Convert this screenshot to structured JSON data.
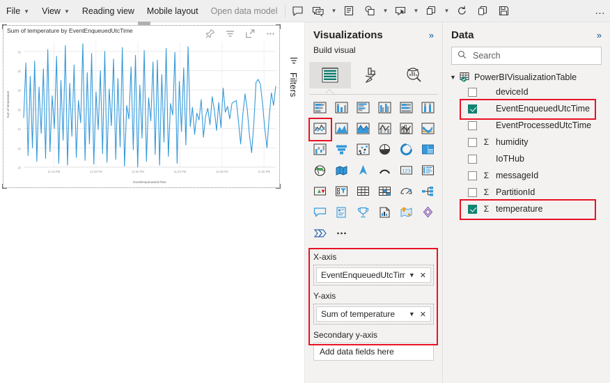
{
  "ribbon": {
    "menus": [
      {
        "label": "File",
        "caret": true,
        "dim": false
      },
      {
        "label": "View",
        "caret": true,
        "dim": false
      },
      {
        "label": "Reading view",
        "caret": false,
        "dim": false
      },
      {
        "label": "Mobile layout",
        "caret": false,
        "dim": false
      },
      {
        "label": "Open data model",
        "caret": false,
        "dim": true
      }
    ],
    "icons": [
      {
        "name": "comment-icon",
        "caret": false
      },
      {
        "name": "chat-bubbles-icon",
        "caret": true
      },
      {
        "name": "text-pane-icon",
        "caret": false
      },
      {
        "name": "shapes-icon",
        "caret": true
      },
      {
        "name": "buttons-icon",
        "caret": true
      },
      {
        "name": "layers-icon",
        "caret": true
      },
      {
        "name": "refresh-icon",
        "caret": false
      },
      {
        "name": "copy-icon",
        "caret": false
      },
      {
        "name": "save-icon",
        "caret": false
      }
    ],
    "overflow_label": "…"
  },
  "visual": {
    "title": "Sum of temperature by EventEnqueuedUtcTime",
    "actions": [
      {
        "name": "pin-icon",
        "tooltip": "Pin to dashboard"
      },
      {
        "name": "filter-icon",
        "tooltip": "Filters"
      },
      {
        "name": "focus-mode-icon",
        "tooltip": "Focus mode"
      },
      {
        "name": "more-options-icon",
        "tooltip": "More options"
      }
    ]
  },
  "chart_data": {
    "type": "line",
    "title": "Sum of temperature by EventEnqueuedUtcTime",
    "xlabel": "EventEnqueuedUtcTime",
    "ylabel": "Sum of temperature",
    "series_color": "#3599da",
    "grid": true,
    "legend": "none",
    "ylim": [
      20,
      33
    ],
    "ytick_labels": [
      "32",
      "30",
      "28",
      "26",
      "24",
      "22",
      "20"
    ],
    "ytick_values": [
      32,
      30,
      28,
      26,
      24,
      22,
      20
    ],
    "xtick_labels": [
      "11:10 PM",
      "11:15 PM",
      "11:20 PM",
      "11:25 PM",
      "11:30 PM",
      "11:35 PM"
    ],
    "x": [
      0,
      1,
      2,
      3,
      4,
      5,
      6,
      7,
      8,
      9,
      10,
      11,
      12,
      13,
      14,
      15,
      16,
      17,
      18,
      19,
      20,
      21,
      22,
      23,
      24,
      25,
      26,
      27,
      28,
      29,
      30,
      31,
      32,
      33,
      34,
      35,
      36,
      37,
      38,
      39,
      40,
      41,
      42,
      43,
      44,
      45,
      46,
      47,
      48,
      49,
      50,
      51,
      52,
      53,
      54,
      55,
      56,
      57,
      58,
      59,
      60,
      61,
      62,
      63,
      64,
      65,
      66,
      67,
      68,
      69,
      70,
      71,
      72,
      73,
      74,
      75,
      76,
      77,
      78,
      79,
      80,
      81,
      82,
      83,
      84,
      85,
      86,
      87,
      88,
      89,
      90,
      91,
      92,
      93,
      94,
      95,
      96,
      97,
      98,
      99,
      100,
      101,
      102,
      103,
      104,
      105,
      106,
      107,
      108,
      109,
      110,
      111,
      112,
      113,
      114,
      115
    ],
    "values": [
      25.1,
      30.8,
      21.2,
      29.4,
      22.0,
      31.0,
      20.6,
      28.3,
      23.5,
      30.2,
      20.9,
      32.2,
      21.6,
      27.4,
      24.0,
      31.5,
      20.4,
      29.0,
      22.8,
      32.6,
      20.2,
      28.7,
      23.2,
      30.6,
      21.0,
      26.9,
      24.6,
      32.8,
      20.7,
      29.8,
      22.4,
      31.8,
      20.3,
      27.8,
      23.9,
      30.0,
      21.4,
      32.0,
      20.5,
      28.1,
      24.3,
      31.2,
      20.8,
      29.2,
      22.1,
      32.4,
      20.1,
      26.4,
      25.0,
      30.4,
      21.8,
      31.6,
      20.0,
      28.5,
      23.0,
      32.1,
      20.6,
      27.2,
      24.8,
      30.9,
      21.3,
      31.1,
      20.2,
      29.6,
      22.6,
      32.3,
      21.1,
      26.6,
      25.4,
      31.9,
      20.4,
      28.9,
      23.7,
      30.3,
      22.3,
      32.5,
      24.2,
      26.2,
      23.4,
      25.6,
      24.9,
      27.0,
      23.1,
      25.3,
      26.1,
      24.4,
      27.3,
      25.9,
      23.8,
      26.7,
      24.1,
      28.2,
      25.7,
      26.3,
      25.0,
      26.6,
      26.8,
      26.9,
      24.7,
      22.4,
      25.5,
      27.6,
      26.0,
      23.3,
      21.5,
      24.5,
      28.8,
      29.1,
      28.6,
      26.5,
      24.0,
      22.0,
      25.2,
      27.7,
      26.4,
      28.4
    ]
  },
  "filters_pane": {
    "label": "Filters",
    "icon": "filter-icon"
  },
  "visualizations_pane": {
    "title": "Visualizations",
    "expand_icon": "»",
    "section_label": "Build visual",
    "build_tabs": [
      {
        "name": "build-visual-tab",
        "icon": "fields-table-icon",
        "active": true
      },
      {
        "name": "format-visual-tab",
        "icon": "paintbrush-icon",
        "active": false
      },
      {
        "name": "analytics-tab",
        "icon": "magnifier-chart-icon",
        "active": false
      }
    ],
    "gallery": [
      {
        "name": "stacked-bar-chart",
        "selected": false
      },
      {
        "name": "stacked-column-chart",
        "selected": false
      },
      {
        "name": "clustered-bar-chart",
        "selected": false
      },
      {
        "name": "clustered-column-chart",
        "selected": false
      },
      {
        "name": "100-stacked-bar-chart",
        "selected": false
      },
      {
        "name": "100-stacked-column-chart",
        "selected": false
      },
      {
        "name": "line-chart",
        "selected": true
      },
      {
        "name": "area-chart",
        "selected": false
      },
      {
        "name": "stacked-area-chart",
        "selected": false
      },
      {
        "name": "line-and-stacked-column-chart",
        "selected": false
      },
      {
        "name": "line-and-clustered-column-chart",
        "selected": false
      },
      {
        "name": "ribbon-chart",
        "selected": false
      },
      {
        "name": "waterfall-chart",
        "selected": false
      },
      {
        "name": "funnel-chart",
        "selected": false
      },
      {
        "name": "scatter-chart",
        "selected": false
      },
      {
        "name": "pie-chart",
        "selected": false
      },
      {
        "name": "donut-chart",
        "selected": false
      },
      {
        "name": "treemap",
        "selected": false
      },
      {
        "name": "map",
        "selected": false
      },
      {
        "name": "filled-map",
        "selected": false
      },
      {
        "name": "azure-map",
        "selected": false
      },
      {
        "name": "arcgis-map",
        "selected": false
      },
      {
        "name": "card",
        "selected": false
      },
      {
        "name": "multi-row-card",
        "selected": false
      },
      {
        "name": "kpi",
        "selected": false
      },
      {
        "name": "slicer",
        "selected": false
      },
      {
        "name": "table",
        "selected": false
      },
      {
        "name": "matrix",
        "selected": false
      },
      {
        "name": "gauge",
        "selected": false
      },
      {
        "name": "decomposition-tree",
        "selected": false
      },
      {
        "name": "q-and-a",
        "selected": false
      },
      {
        "name": "smart-narrative",
        "selected": false
      },
      {
        "name": "key-influencers",
        "selected": false
      },
      {
        "name": "paginated-report",
        "selected": false
      },
      {
        "name": "arcgis-maps-visual",
        "selected": false
      },
      {
        "name": "power-apps-visual",
        "selected": false
      },
      {
        "name": "power-automate-visual",
        "selected": false
      },
      {
        "name": "more-visuals",
        "selected": false
      }
    ],
    "wells": [
      {
        "name": "x-axis-well",
        "label": "X-axis",
        "field": "EventEnqueuedUtcTime",
        "empty_text": null,
        "highlighted": true
      },
      {
        "name": "y-axis-well",
        "label": "Y-axis",
        "field": "Sum of temperature",
        "empty_text": null,
        "highlighted": true
      },
      {
        "name": "secondary-y-axis-well",
        "label": "Secondary y-axis",
        "field": null,
        "empty_text": "Add data fields here",
        "highlighted": false
      }
    ]
  },
  "data_pane": {
    "title": "Data",
    "expand_icon": "»",
    "search_placeholder": "Search",
    "search_value": "",
    "table": {
      "name": "PowerBIVisualizationTable",
      "expanded": true
    },
    "fields": [
      {
        "name": "deviceId",
        "checked": false,
        "measure": false,
        "highlighted": false
      },
      {
        "name": "EventEnqueuedUtcTime",
        "checked": true,
        "measure": false,
        "highlighted": true
      },
      {
        "name": "EventProcessedUtcTime",
        "checked": false,
        "measure": false,
        "highlighted": false
      },
      {
        "name": "humidity",
        "checked": false,
        "measure": true,
        "highlighted": false
      },
      {
        "name": "IoTHub",
        "checked": false,
        "measure": false,
        "highlighted": false
      },
      {
        "name": "messageId",
        "checked": false,
        "measure": true,
        "highlighted": false
      },
      {
        "name": "PartitionId",
        "checked": false,
        "measure": true,
        "highlighted": false
      },
      {
        "name": "temperature",
        "checked": true,
        "measure": true,
        "highlighted": true
      }
    ]
  },
  "colors": {
    "accent_blue": "#3599da",
    "highlight_red": "#e81123",
    "checkbox_green": "#118472",
    "pane_bg": "#f3f2f1"
  }
}
